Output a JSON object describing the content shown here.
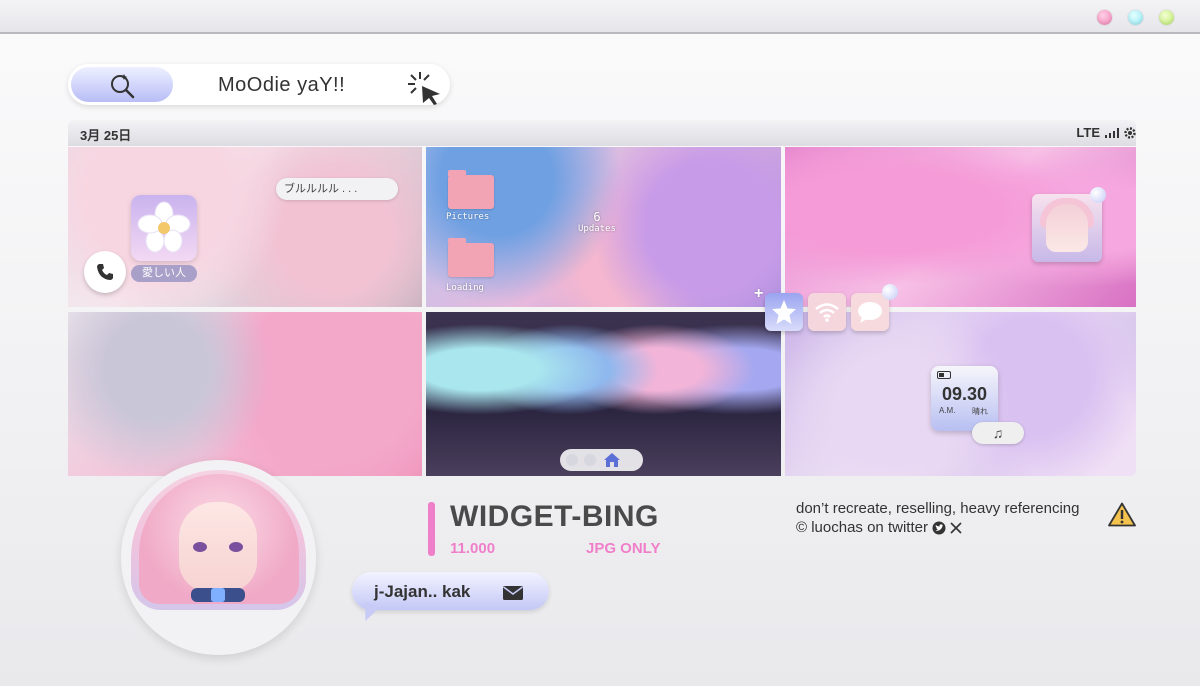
{
  "window": {
    "controls": [
      "close",
      "minimize",
      "maximize"
    ]
  },
  "search": {
    "text": "MoOdie yaY!!"
  },
  "status": {
    "date": "3月 25日",
    "network": "LTE"
  },
  "tiles": {
    "t1": {
      "bubble": "ブルルルル . . .",
      "app_label": "愛しい人"
    },
    "t2": {
      "folder1": "Pictures",
      "folder2": "Loading",
      "badge": "6",
      "updates": "Updates"
    },
    "t6": {
      "time": "09.30",
      "ampm": "A.M.",
      "weather": "晴れ"
    }
  },
  "product": {
    "title": "WIDGET-BING",
    "price": "11.000",
    "format": "JPG ONLY"
  },
  "notice": {
    "line1": "don’t recreate, reselling, heavy referencing",
    "line2": "© luochas on twitter"
  },
  "chat": {
    "text": "j-Jajan.. kak"
  },
  "colors": {
    "accent_pink": "#f07fca",
    "lavender": "#b8bdf6"
  }
}
